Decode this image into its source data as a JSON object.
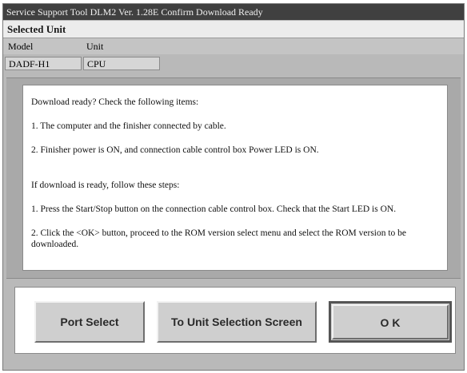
{
  "window": {
    "title": "Service Support Tool DLM2 Ver. 1.28E  Confirm Download Ready"
  },
  "selected_unit": {
    "heading": "Selected Unit",
    "columns": [
      "Model",
      "Unit"
    ],
    "model_value": "DADF-H1",
    "unit_value": "CPU"
  },
  "message": {
    "intro": "Download ready? Check the following items:",
    "check_1": "1. The computer and the finisher connected by cable.",
    "check_2": "2. Finisher power is ON, and connection cable control box Power LED is ON.",
    "steps_intro": "If download is ready, follow these steps:",
    "step_1": "1. Press the Start/Stop button on the connection cable control box. Check that the Start LED is ON.",
    "step_2": "2. Click the <OK> button, proceed to the ROM version select menu and select the ROM version to be downloaded."
  },
  "buttons": {
    "port_select": "Port Select",
    "unit_selection": "To Unit Selection Screen",
    "ok": "O K"
  }
}
